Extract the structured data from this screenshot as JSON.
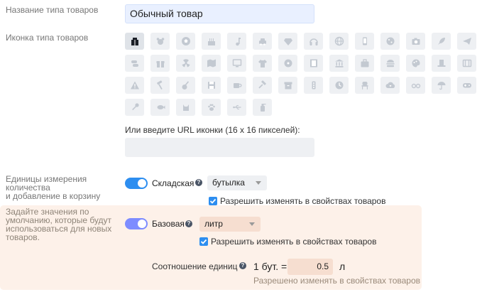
{
  "fields": {
    "type_name_label": "Название типа товаров",
    "type_name_value": "Обычный товар",
    "icon_label": "Иконка типа товаров",
    "url_label": "Или введите URL иконки (16 x 16 пикселей):",
    "url_value": ""
  },
  "icons": [
    {
      "name": "box",
      "selected": true
    },
    {
      "name": "bear",
      "selected": false
    },
    {
      "name": "soccer-ball",
      "selected": false
    },
    {
      "name": "cake",
      "selected": false
    },
    {
      "name": "music-note",
      "selected": false
    },
    {
      "name": "car",
      "selected": false
    },
    {
      "name": "diamond",
      "selected": false
    },
    {
      "name": "headphones",
      "selected": false
    },
    {
      "name": "globe",
      "selected": false
    },
    {
      "name": "phone",
      "selected": false
    },
    {
      "name": "cookie",
      "selected": false
    },
    {
      "name": "camera",
      "selected": false
    },
    {
      "name": "rocket",
      "selected": false
    },
    {
      "name": "paper-plane",
      "selected": false
    },
    {
      "name": "pills",
      "selected": false
    },
    {
      "name": "gift",
      "selected": false
    },
    {
      "name": "radiation",
      "selected": false
    },
    {
      "name": "map",
      "selected": false
    },
    {
      "name": "monitor",
      "selected": false
    },
    {
      "name": "t-shirt",
      "selected": false
    },
    {
      "name": "disc",
      "selected": false
    },
    {
      "name": "film-strip",
      "selected": false
    },
    {
      "name": "bank",
      "selected": false
    },
    {
      "name": "briefcase",
      "selected": false
    },
    {
      "name": "burger",
      "selected": false
    },
    {
      "name": "palette",
      "selected": false
    },
    {
      "name": "top-hat",
      "selected": false
    },
    {
      "name": "film",
      "selected": false
    },
    {
      "name": "warning",
      "selected": false
    },
    {
      "name": "hammer",
      "selected": false
    },
    {
      "name": "guitar",
      "selected": false
    },
    {
      "name": "floppy-disk",
      "selected": false
    },
    {
      "name": "coffee-cup",
      "selected": false
    },
    {
      "name": "gavel",
      "selected": false
    },
    {
      "name": "archive",
      "selected": false
    },
    {
      "name": "traffic-light",
      "selected": false
    },
    {
      "name": "clock",
      "selected": false
    },
    {
      "name": "chair",
      "selected": false
    },
    {
      "name": "cloud-download",
      "selected": false
    },
    {
      "name": "glasses",
      "selected": false
    },
    {
      "name": "umbrella",
      "selected": false
    },
    {
      "name": "gamepad",
      "selected": false
    },
    {
      "name": "key",
      "selected": false
    },
    {
      "name": "fish",
      "selected": false
    },
    {
      "name": "cat",
      "selected": false
    },
    {
      "name": "paw",
      "selected": false
    },
    {
      "name": "usb",
      "selected": false
    },
    {
      "name": "spray-bottle",
      "selected": false
    }
  ],
  "units": {
    "label_lines": [
      "Единицы измерения",
      "количества",
      "и добавление в корзину"
    ],
    "hint_lines": [
      "Задайте значения по",
      "умолчанию, которые будут",
      "использоваться для новых",
      "товаров."
    ],
    "stock": {
      "name": "Складская",
      "enabled": true,
      "select_value": "бутылка",
      "checkbox_checked": true,
      "checkbox_label": "Разрешить изменять в свойствах товаров"
    },
    "base": {
      "name": "Базовая",
      "enabled": true,
      "select_value": "литр",
      "checkbox_checked": true,
      "checkbox_label": "Разрешить изменять в свойствах товаров"
    },
    "ratio": {
      "label": "Соотношение единиц",
      "left": "1 бут. =",
      "value": "0.5",
      "unit": "л",
      "note": "Разрешено изменять в свойствах товаров"
    },
    "help_glyph": "?"
  },
  "colors": {
    "accent": "#2d8ef0",
    "toggle_soft": "#7d8cff",
    "hint_bg": "#fdf1e9",
    "input_bg": "#e9f0ff",
    "icon_bg": "#eef0f3"
  }
}
